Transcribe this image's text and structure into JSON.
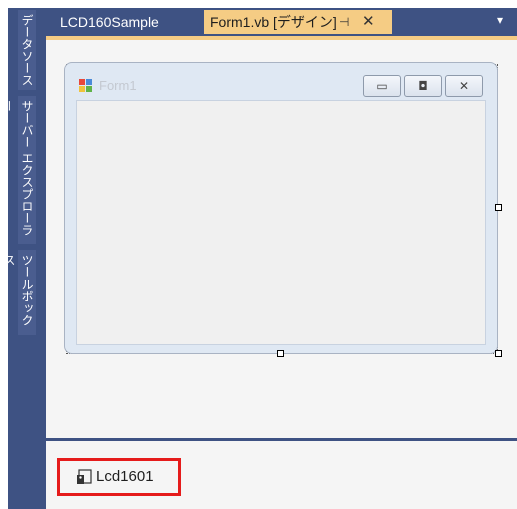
{
  "sidebar": {
    "tabs": [
      {
        "label": "データソース"
      },
      {
        "label": "サーバー エクスプローラー"
      },
      {
        "label": "ツールボックス"
      }
    ]
  },
  "tabs": [
    {
      "label": "LCD160Sample"
    },
    {
      "label": "Form1.vb [デザイン]",
      "pin_icon": "pin-icon",
      "close_icon": "close-icon"
    }
  ],
  "form": {
    "title": "Form1",
    "controls": [
      "minimize-icon",
      "maximize-icon",
      "close-icon"
    ]
  },
  "tray": {
    "component_label": "Lcd1601"
  },
  "colors": {
    "accent_tab": "#f5cc84",
    "chrome": "#3e5283",
    "highlight": "#e51b1b"
  }
}
